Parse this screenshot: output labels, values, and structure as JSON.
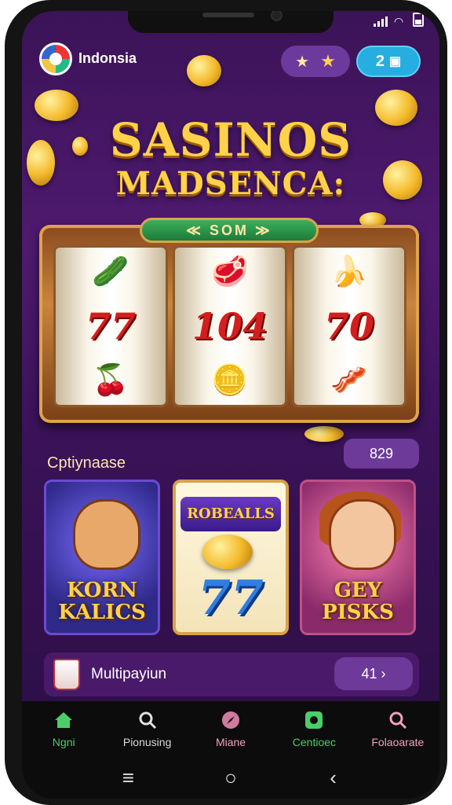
{
  "header": {
    "app_name": "Indonsia",
    "balance_value": "2",
    "balance_icon": "wallet-icon",
    "stars_icons": [
      "star-outline-icon",
      "star-icon"
    ]
  },
  "hero": {
    "title_line1": "SASINOS",
    "title_line2": "MADSENCA:"
  },
  "slot_machine": {
    "label": "≪ SOM ≫",
    "reels": [
      {
        "top": "🥒",
        "middle": "77",
        "bottom": "🍒"
      },
      {
        "top": "🥩",
        "middle": "104",
        "bottom": "🪙"
      },
      {
        "top": "🍌",
        "middle": "70",
        "bottom": "🥓"
      }
    ]
  },
  "section": {
    "label": "Cptiynaase",
    "badge": "829"
  },
  "game_cards": [
    {
      "title_line1": "KORN",
      "title_line2": "KALICS"
    },
    {
      "banner": "ROBEALLS",
      "symbol": "77"
    },
    {
      "title_line1": "GEY",
      "title_line2": "PISKS"
    }
  ],
  "multiplayer": {
    "label": "Multipayiun",
    "badge": "41 ›"
  },
  "bottom_nav": [
    {
      "label": "Ngni",
      "icon": "home-icon"
    },
    {
      "label": "Pionusing",
      "icon": "search-icon"
    },
    {
      "label": "Miane",
      "icon": "compass-icon"
    },
    {
      "label": "Centioec",
      "icon": "chat-icon"
    },
    {
      "label": "Folaoarate",
      "icon": "search-icon"
    }
  ],
  "system_nav": {
    "recents": "recents-icon",
    "home": "home-circle-icon",
    "back": "back-icon"
  },
  "colors": {
    "background": "#3b1357",
    "accent_gold": "#ffd24a",
    "accent_blue": "#27aee0",
    "nav_green": "#4ccd6a"
  }
}
